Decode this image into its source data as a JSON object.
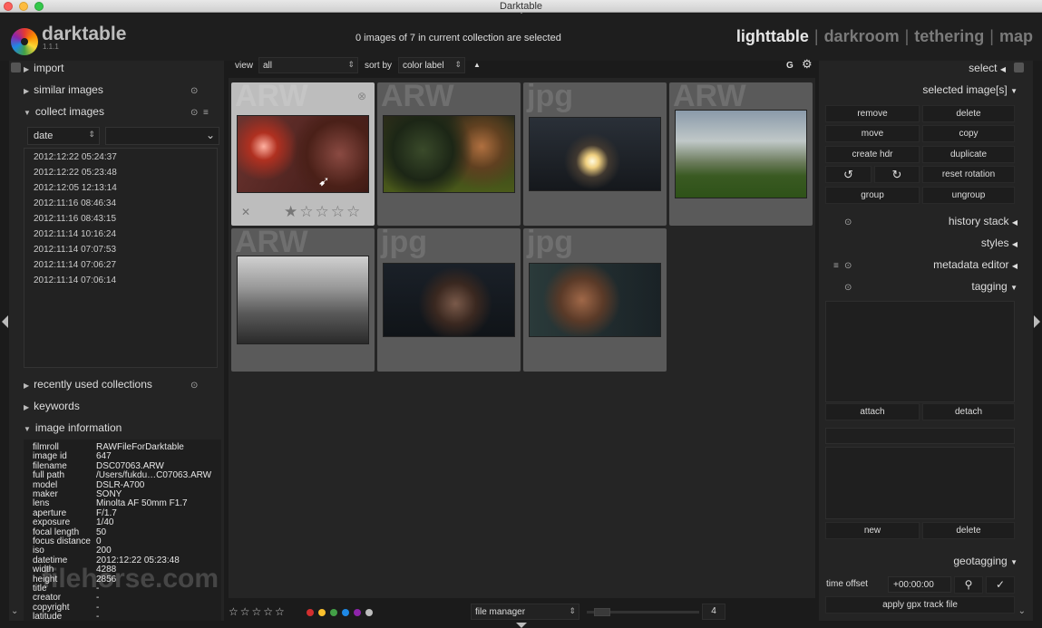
{
  "window": {
    "title": "Darktable"
  },
  "app": {
    "name": "darktable",
    "version": "1.1.1"
  },
  "status": {
    "selection_text": "0 images of 7 in current collection are selected"
  },
  "views": [
    {
      "label": "lighttable"
    },
    {
      "label": "darkroom"
    },
    {
      "label": "tethering"
    },
    {
      "label": "map"
    }
  ],
  "toolbar": {
    "view_label": "view",
    "view_value": "all",
    "sort_label": "sort by",
    "sort_value": "color label",
    "sort_dir": "▲",
    "grouping": "G",
    "settings_icon": "⚙"
  },
  "left": {
    "import": "import",
    "similar": "similar images",
    "collect": "collect images",
    "filter_field": "date",
    "dates": [
      "2012:12:22 05:24:37",
      "2012:12:22 05:23:48",
      "2012:12:05 12:13:14",
      "2012:11:16 08:46:34",
      "2012:11:16 08:43:15",
      "2012:11:14 10:16:24",
      "2012:11:14 07:07:53",
      "2012:11:14 07:06:27",
      "2012:11:14 07:06:14"
    ],
    "recent": "recently used collections",
    "keywords": "keywords",
    "image_info": "image information",
    "info": [
      [
        "filmroll",
        "RAWFileForDarktable"
      ],
      [
        "image id",
        "647"
      ],
      [
        "filename",
        "DSC07063.ARW"
      ],
      [
        "full path",
        "/Users/fukdu…C07063.ARW"
      ],
      [
        "model",
        "DSLR-A700"
      ],
      [
        "maker",
        "SONY"
      ],
      [
        "lens",
        "Minolta AF 50mm F1.7"
      ],
      [
        "aperture",
        "F/1.7"
      ],
      [
        "exposure",
        "1/40"
      ],
      [
        "focal length",
        "50"
      ],
      [
        "focus distance",
        "0"
      ],
      [
        "iso",
        "200"
      ],
      [
        "datetime",
        "2012:12:22 05:23:48"
      ],
      [
        "width",
        "4288"
      ],
      [
        "height",
        "2856"
      ],
      [
        "title",
        "-"
      ],
      [
        "creator",
        "-"
      ],
      [
        "copyright",
        "-"
      ],
      [
        "latitude",
        "-"
      ]
    ]
  },
  "thumbs": [
    {
      "ext": "ARW"
    },
    {
      "ext": "ARW"
    },
    {
      "ext": "jpg"
    },
    {
      "ext": "ARW"
    },
    {
      "ext": "ARW"
    },
    {
      "ext": "jpg"
    },
    {
      "ext": "jpg"
    }
  ],
  "right": {
    "select": "select",
    "selected_images": "selected image[s]",
    "buttons": {
      "remove": "remove",
      "delete": "delete",
      "move": "move",
      "copy": "copy",
      "create_hdr": "create hdr",
      "duplicate": "duplicate",
      "rotate_ccw": "↺",
      "rotate_cw": "↻",
      "reset_rotation": "reset rotation",
      "group": "group",
      "ungroup": "ungroup"
    },
    "history_stack": "history stack",
    "styles": "styles",
    "metadata_editor": "metadata editor",
    "tagging": "tagging",
    "attach": "attach",
    "detach": "detach",
    "new": "new",
    "delete_tag": "delete",
    "geotagging": "geotagging",
    "time_offset_label": "time offset",
    "time_offset_value": "+00:00:00",
    "apply_gpx": "apply gpx track file"
  },
  "bottom": {
    "stars": "☆☆☆☆☆",
    "layout": "file manager",
    "zoom": "4"
  },
  "color_labels": [
    "#d32f2f",
    "#fbc02d",
    "#43a047",
    "#1e88e5",
    "#8e24aa",
    "#bdbdbd"
  ],
  "watermark": "filehorse.com"
}
